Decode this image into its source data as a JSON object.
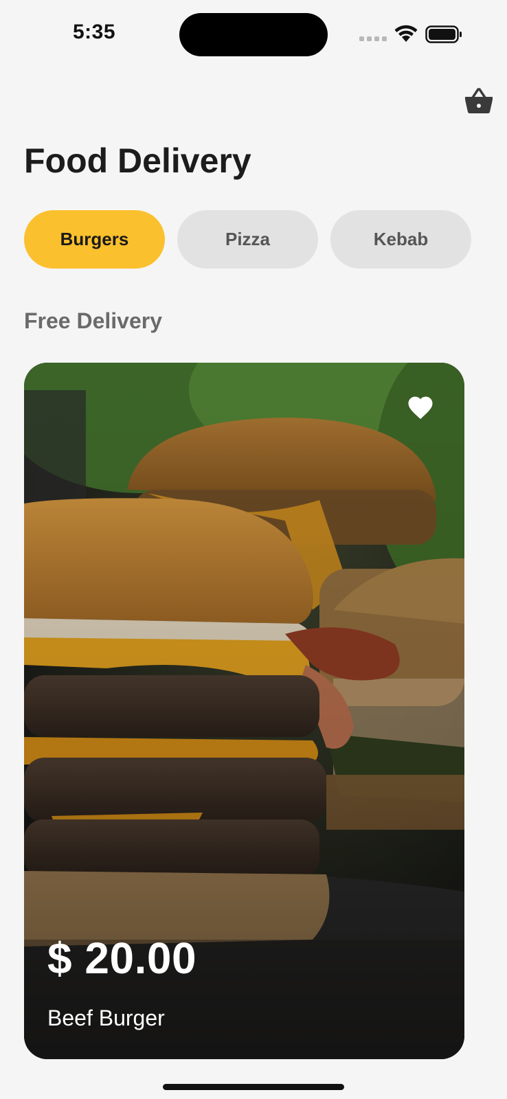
{
  "status_bar": {
    "time": "5:35"
  },
  "header": {
    "cart_icon": "basket-icon"
  },
  "title": "Food Delivery",
  "categories": [
    {
      "label": "Burgers",
      "active": true
    },
    {
      "label": "Pizza",
      "active": false
    },
    {
      "label": "Kebab",
      "active": false
    }
  ],
  "section": {
    "title": "Free Delivery"
  },
  "featured_item": {
    "price": "$ 20.00",
    "name": "Beef Burger",
    "favorite_icon": "heart-icon",
    "favorited": true
  },
  "colors": {
    "accent": "#fbc02d",
    "chip_inactive": "#e2e2e2",
    "background": "#f5f5f5",
    "title": "#1c1c1c"
  }
}
